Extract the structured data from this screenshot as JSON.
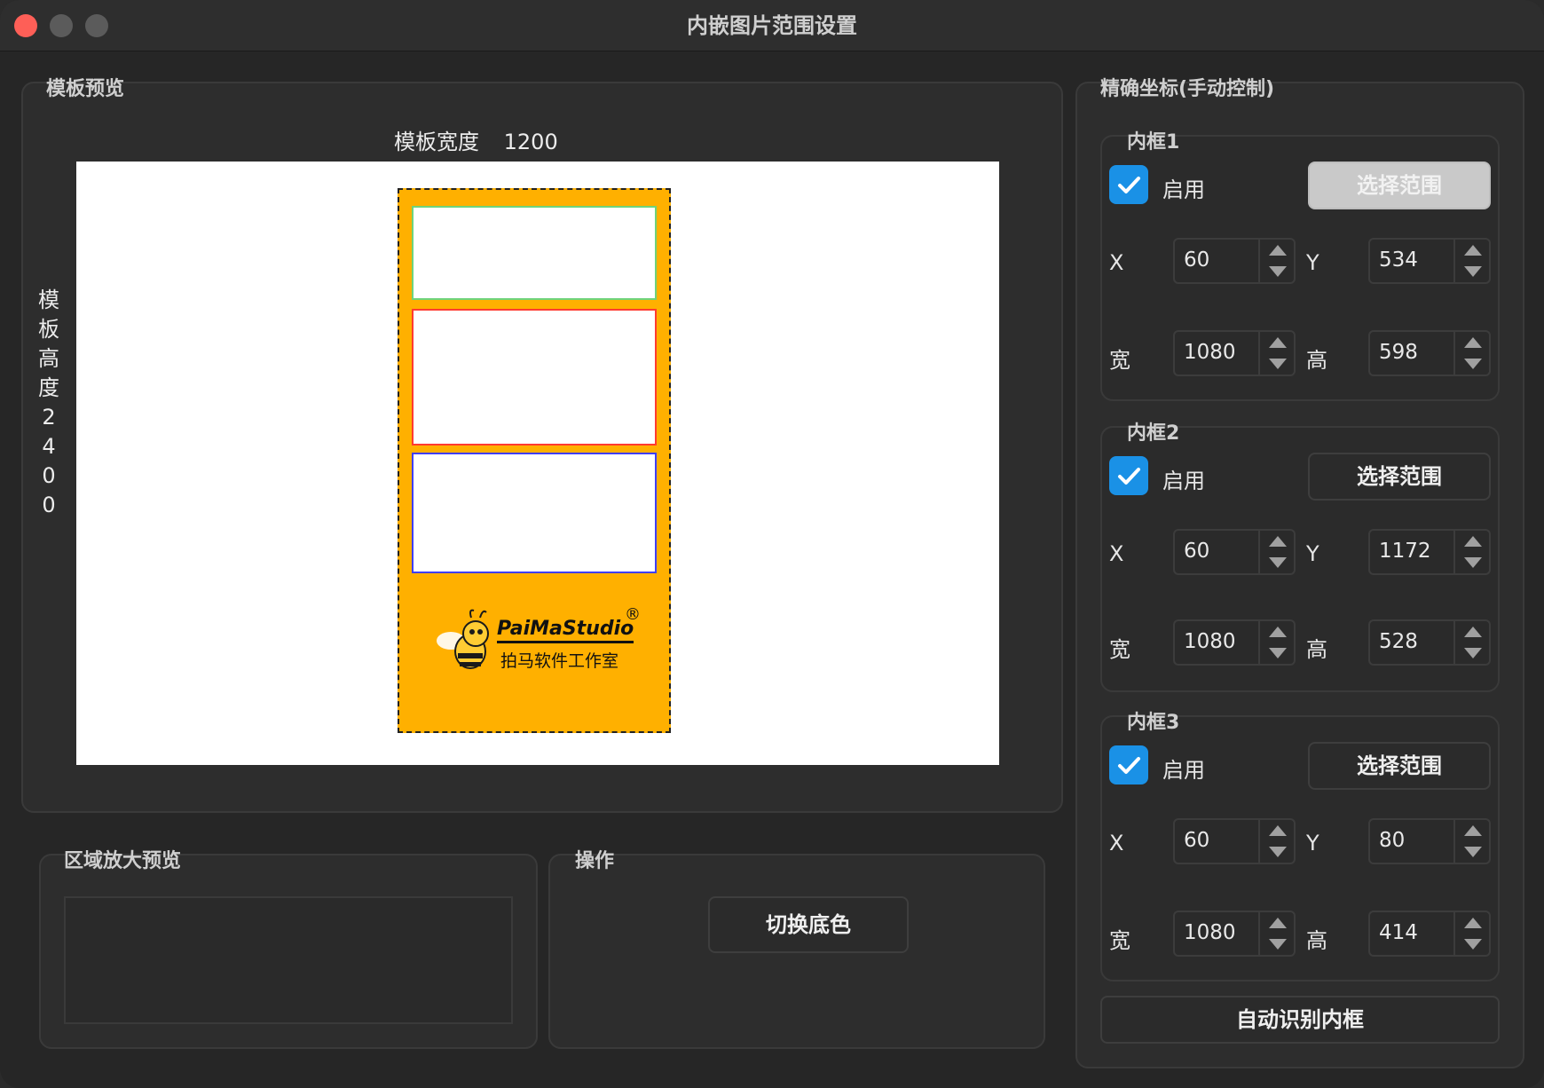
{
  "window": {
    "title": "内嵌图片范围设置"
  },
  "template_preview": {
    "group_title": "模板预览",
    "width_label": "模板宽度",
    "width_value": "1200",
    "height_label_chars": [
      "模",
      "板",
      "高",
      "度",
      "2",
      "4",
      "0",
      "0"
    ],
    "background_color": "#ffb000",
    "frames": [
      {
        "border_color": "#6fd37b"
      },
      {
        "border_color": "#ff3b30"
      },
      {
        "border_color": "#3f3fff"
      }
    ],
    "logo": {
      "brand": "PaiMaStudio",
      "registered": "®",
      "subtitle": "拍马软件工作室"
    }
  },
  "zoom_preview": {
    "group_title": "区域放大预览"
  },
  "operations": {
    "group_title": "操作",
    "toggle_bg_label": "切换底色"
  },
  "manual": {
    "group_title": "精确坐标(手动控制)",
    "frames": [
      {
        "title": "内框1",
        "enabled_label": "启用",
        "select_label": "选择范围",
        "x_label": "X",
        "x": "60",
        "y_label": "Y",
        "y": "534",
        "w_label": "宽",
        "w": "1080",
        "h_label": "高",
        "h": "598"
      },
      {
        "title": "内框2",
        "enabled_label": "启用",
        "select_label": "选择范围",
        "x_label": "X",
        "x": "60",
        "y_label": "Y",
        "y": "1172",
        "w_label": "宽",
        "w": "1080",
        "h_label": "高",
        "h": "528"
      },
      {
        "title": "内框3",
        "enabled_label": "启用",
        "select_label": "选择范围",
        "x_label": "X",
        "x": "60",
        "y_label": "Y",
        "y": "80",
        "w_label": "宽",
        "w": "1080",
        "h_label": "高",
        "h": "414"
      }
    ],
    "auto_detect_label": "自动识别内框"
  }
}
